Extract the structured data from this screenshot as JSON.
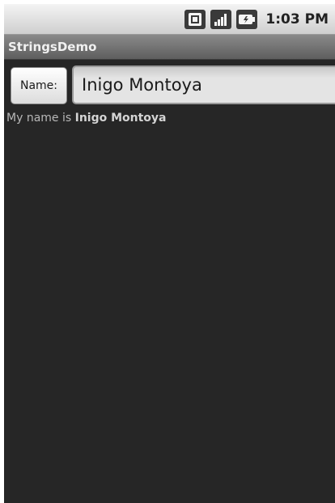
{
  "status_bar": {
    "icons": [
      "sim-icon",
      "signal-icon",
      "battery-icon"
    ],
    "time": "1:03 PM"
  },
  "app": {
    "title": "StringsDemo"
  },
  "form": {
    "name_label": "Name:",
    "name_value": "Inigo Montoya"
  },
  "message": {
    "prefix": "My name is ",
    "name": "Inigo Montoya"
  }
}
